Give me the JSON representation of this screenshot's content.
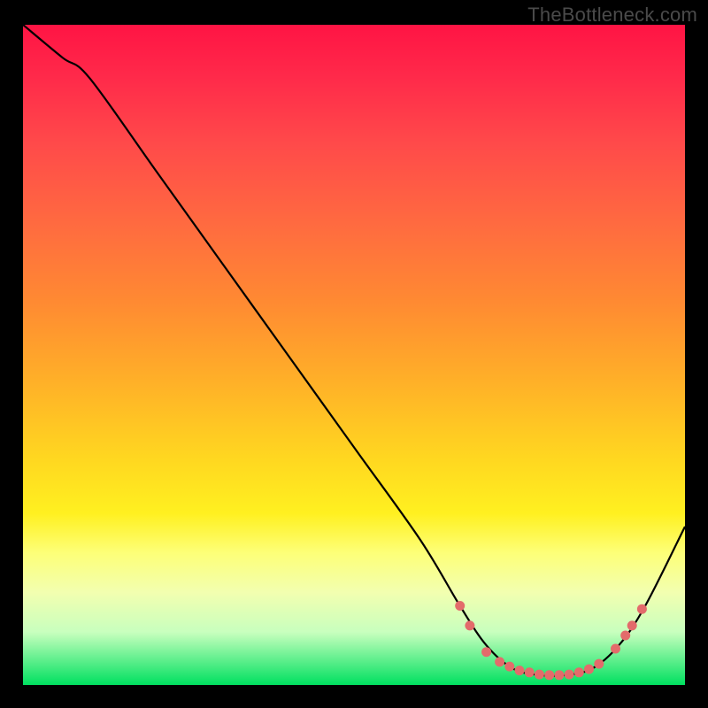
{
  "watermark": {
    "text": "TheBottleneck.com"
  },
  "chart_data": {
    "type": "line",
    "title": "",
    "xlabel": "",
    "ylabel": "",
    "xlim": [
      0,
      100
    ],
    "ylim": [
      0,
      100
    ],
    "series": [
      {
        "name": "bottleneck-curve",
        "x": [
          0,
          6,
          10,
          20,
          30,
          40,
          50,
          60,
          66,
          70,
          74,
          78,
          82,
          86,
          90,
          94,
          100
        ],
        "y": [
          100,
          95,
          92,
          78,
          64,
          50,
          36,
          22,
          12,
          6,
          2.5,
          1.5,
          1.5,
          2.5,
          6,
          12,
          24
        ]
      }
    ],
    "markers": {
      "name": "highlight-dots",
      "color": "#e36b6b",
      "points": [
        {
          "x": 66.0,
          "y": 12.0
        },
        {
          "x": 67.5,
          "y": 9.0
        },
        {
          "x": 70.0,
          "y": 5.0
        },
        {
          "x": 72.0,
          "y": 3.5
        },
        {
          "x": 73.5,
          "y": 2.8
        },
        {
          "x": 75.0,
          "y": 2.2
        },
        {
          "x": 76.5,
          "y": 1.9
        },
        {
          "x": 78.0,
          "y": 1.6
        },
        {
          "x": 79.5,
          "y": 1.5
        },
        {
          "x": 81.0,
          "y": 1.5
        },
        {
          "x": 82.5,
          "y": 1.6
        },
        {
          "x": 84.0,
          "y": 1.9
        },
        {
          "x": 85.5,
          "y": 2.4
        },
        {
          "x": 87.0,
          "y": 3.2
        },
        {
          "x": 89.5,
          "y": 5.5
        },
        {
          "x": 91.0,
          "y": 7.5
        },
        {
          "x": 92.0,
          "y": 9.0
        },
        {
          "x": 93.5,
          "y": 11.5
        }
      ]
    },
    "gradient_stops": [
      {
        "pos": 0.0,
        "color": "#ff1444"
      },
      {
        "pos": 0.3,
        "color": "#ff6a40"
      },
      {
        "pos": 0.66,
        "color": "#ffd820"
      },
      {
        "pos": 0.86,
        "color": "#f2ffb0"
      },
      {
        "pos": 1.0,
        "color": "#00e060"
      }
    ]
  }
}
